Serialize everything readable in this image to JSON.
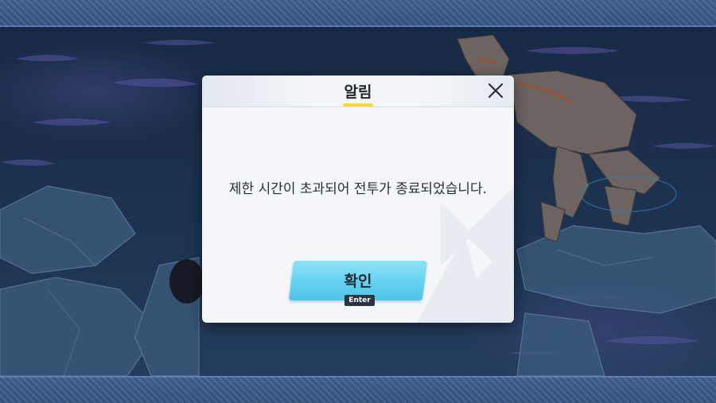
{
  "dialog": {
    "title": "알림",
    "message": "제한 시간이 초과되어 전투가 종료되었습니다.",
    "confirm_label": "확인",
    "confirm_key_hint": "Enter"
  },
  "icons": {
    "close": "close-icon"
  },
  "colors": {
    "title_underline": "#f3d93c",
    "confirm_button": "#63d1ef",
    "top_bar": "#3d5c8a",
    "key_hint_bg": "#2b3440"
  }
}
